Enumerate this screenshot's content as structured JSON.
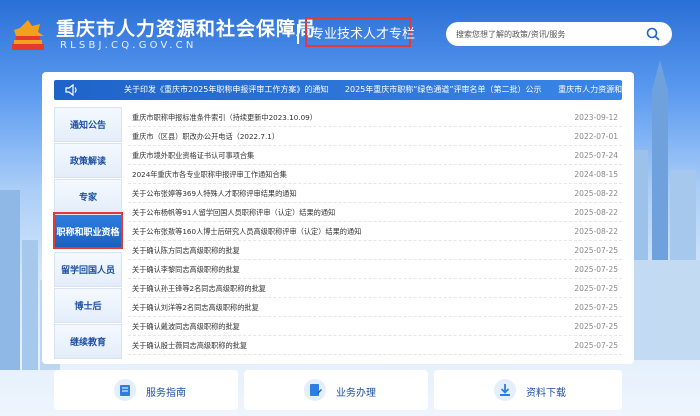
{
  "header": {
    "site_title": "重庆市人力资源和社会保障局",
    "site_url": "RLSBJ.CQ.GOV.CN",
    "subtitle": "专业技术人才专栏",
    "search_placeholder": "搜索您想了解的政策/资讯/服务"
  },
  "notice": {
    "items": [
      "关于印发《重庆市2025年职称申报评审工作方案》的通知",
      "2025年重庆市职称“绿色通道”评审名单（第二批）公示",
      "重庆市人力资源和社会保障局关于公布"
    ]
  },
  "nav": {
    "items": [
      {
        "label": "通知公告"
      },
      {
        "label": "政策解读"
      },
      {
        "label": "专家"
      },
      {
        "label": "职称和职业资格"
      },
      {
        "label": "留学回国人员"
      },
      {
        "label": "博士后"
      },
      {
        "label": "继续教育"
      }
    ]
  },
  "list": {
    "rows": [
      {
        "title": "重庆市职称申报标准条件索引（持续更新中2023.10.09）",
        "date": "2023-09-12"
      },
      {
        "title": "重庆市（区县）职改办公开电话（2022.7.1）",
        "date": "2022-07-01"
      },
      {
        "title": "重庆市境外职业资格证书认可事项合集",
        "date": "2025-07-24"
      },
      {
        "title": "2024年重庆市各专业职称申报评审工作通知合集",
        "date": "2024-08-15"
      },
      {
        "title": "关于公布张婷等369人特殊人才职称评审结果的通知",
        "date": "2025-08-22"
      },
      {
        "title": "关于公布杨帆等91人留学回国人员职称评审（认定）结果的通知",
        "date": "2025-08-22"
      },
      {
        "title": "关于公布张敖等160人博士后研究人员高级职称评审（认定）结果的通知",
        "date": "2025-08-22"
      },
      {
        "title": "关于确认陈方同志高级职称的批复",
        "date": "2025-07-25"
      },
      {
        "title": "关于确认李黎同志高级职称的批复",
        "date": "2025-07-25"
      },
      {
        "title": "关于确认孙王锋等2名同志高级职称的批复",
        "date": "2025-07-25"
      },
      {
        "title": "关于确认刘洋等2名同志高级职称的批复",
        "date": "2025-07-25"
      },
      {
        "title": "关于确认戴波同志高级职称的批复",
        "date": "2025-07-25"
      },
      {
        "title": "关于确认殷士薇同志高级职称的批复",
        "date": "2025-07-25"
      }
    ]
  },
  "bottom": {
    "items": [
      {
        "label": "服务指南",
        "icon": "guide-icon"
      },
      {
        "label": "业务办理",
        "icon": "business-icon"
      },
      {
        "label": "资料下载",
        "icon": "download-icon"
      }
    ]
  },
  "colors": {
    "primary": "#1e63c9",
    "highlight": "#e53935"
  }
}
